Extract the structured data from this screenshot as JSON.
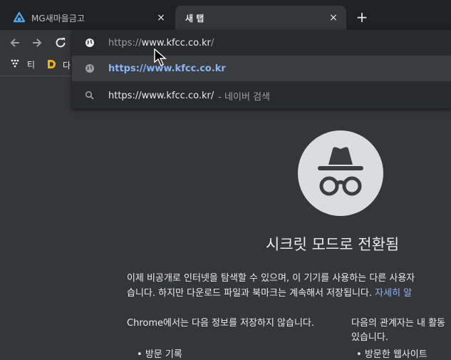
{
  "tabs": [
    {
      "title": "MG새마을금고",
      "close": "×"
    },
    {
      "title": "새 탭",
      "close": "×"
    }
  ],
  "new_tab": "+",
  "bookmarks": [
    {
      "label": "티"
    },
    {
      "label": "다"
    }
  ],
  "omnibox": {
    "input": {
      "prefix": "https://",
      "main": "www.kfcc.co.kr",
      "suffix": "/"
    },
    "suggestions": [
      {
        "text": "https://www.kfcc.co.kr",
        "icon": "globe-icon"
      },
      {
        "text": "https://www.kfcc.co.kr/",
        "suffix": "- 네이버 검색",
        "icon": "search-icon"
      }
    ]
  },
  "incognito": {
    "title": "시크릿 모드로 전환됨",
    "para_line1": "이제 비공개로 인터넷을 탐색할 수 있으며, 이 기기를 사용하는 다른 사용자",
    "para_line2": "습니다. 하지만 다운로드 파일과 북마크는 계속해서 저장됩니다.",
    "learn_more": "자세히 알",
    "left_heading": "Chrome에서는 다음 정보를 저장하지 않습니다.",
    "left_item": "방문 기록",
    "right_heading_l1": "다음의 관계자는 내 활동",
    "right_heading_l2": "있습니다.",
    "right_item": "방문한 웹사이트"
  },
  "colors": {
    "background": "#35363a",
    "tabstrip": "#202124",
    "link": "#8ab4f8",
    "icon_circle": "#dadce0"
  }
}
